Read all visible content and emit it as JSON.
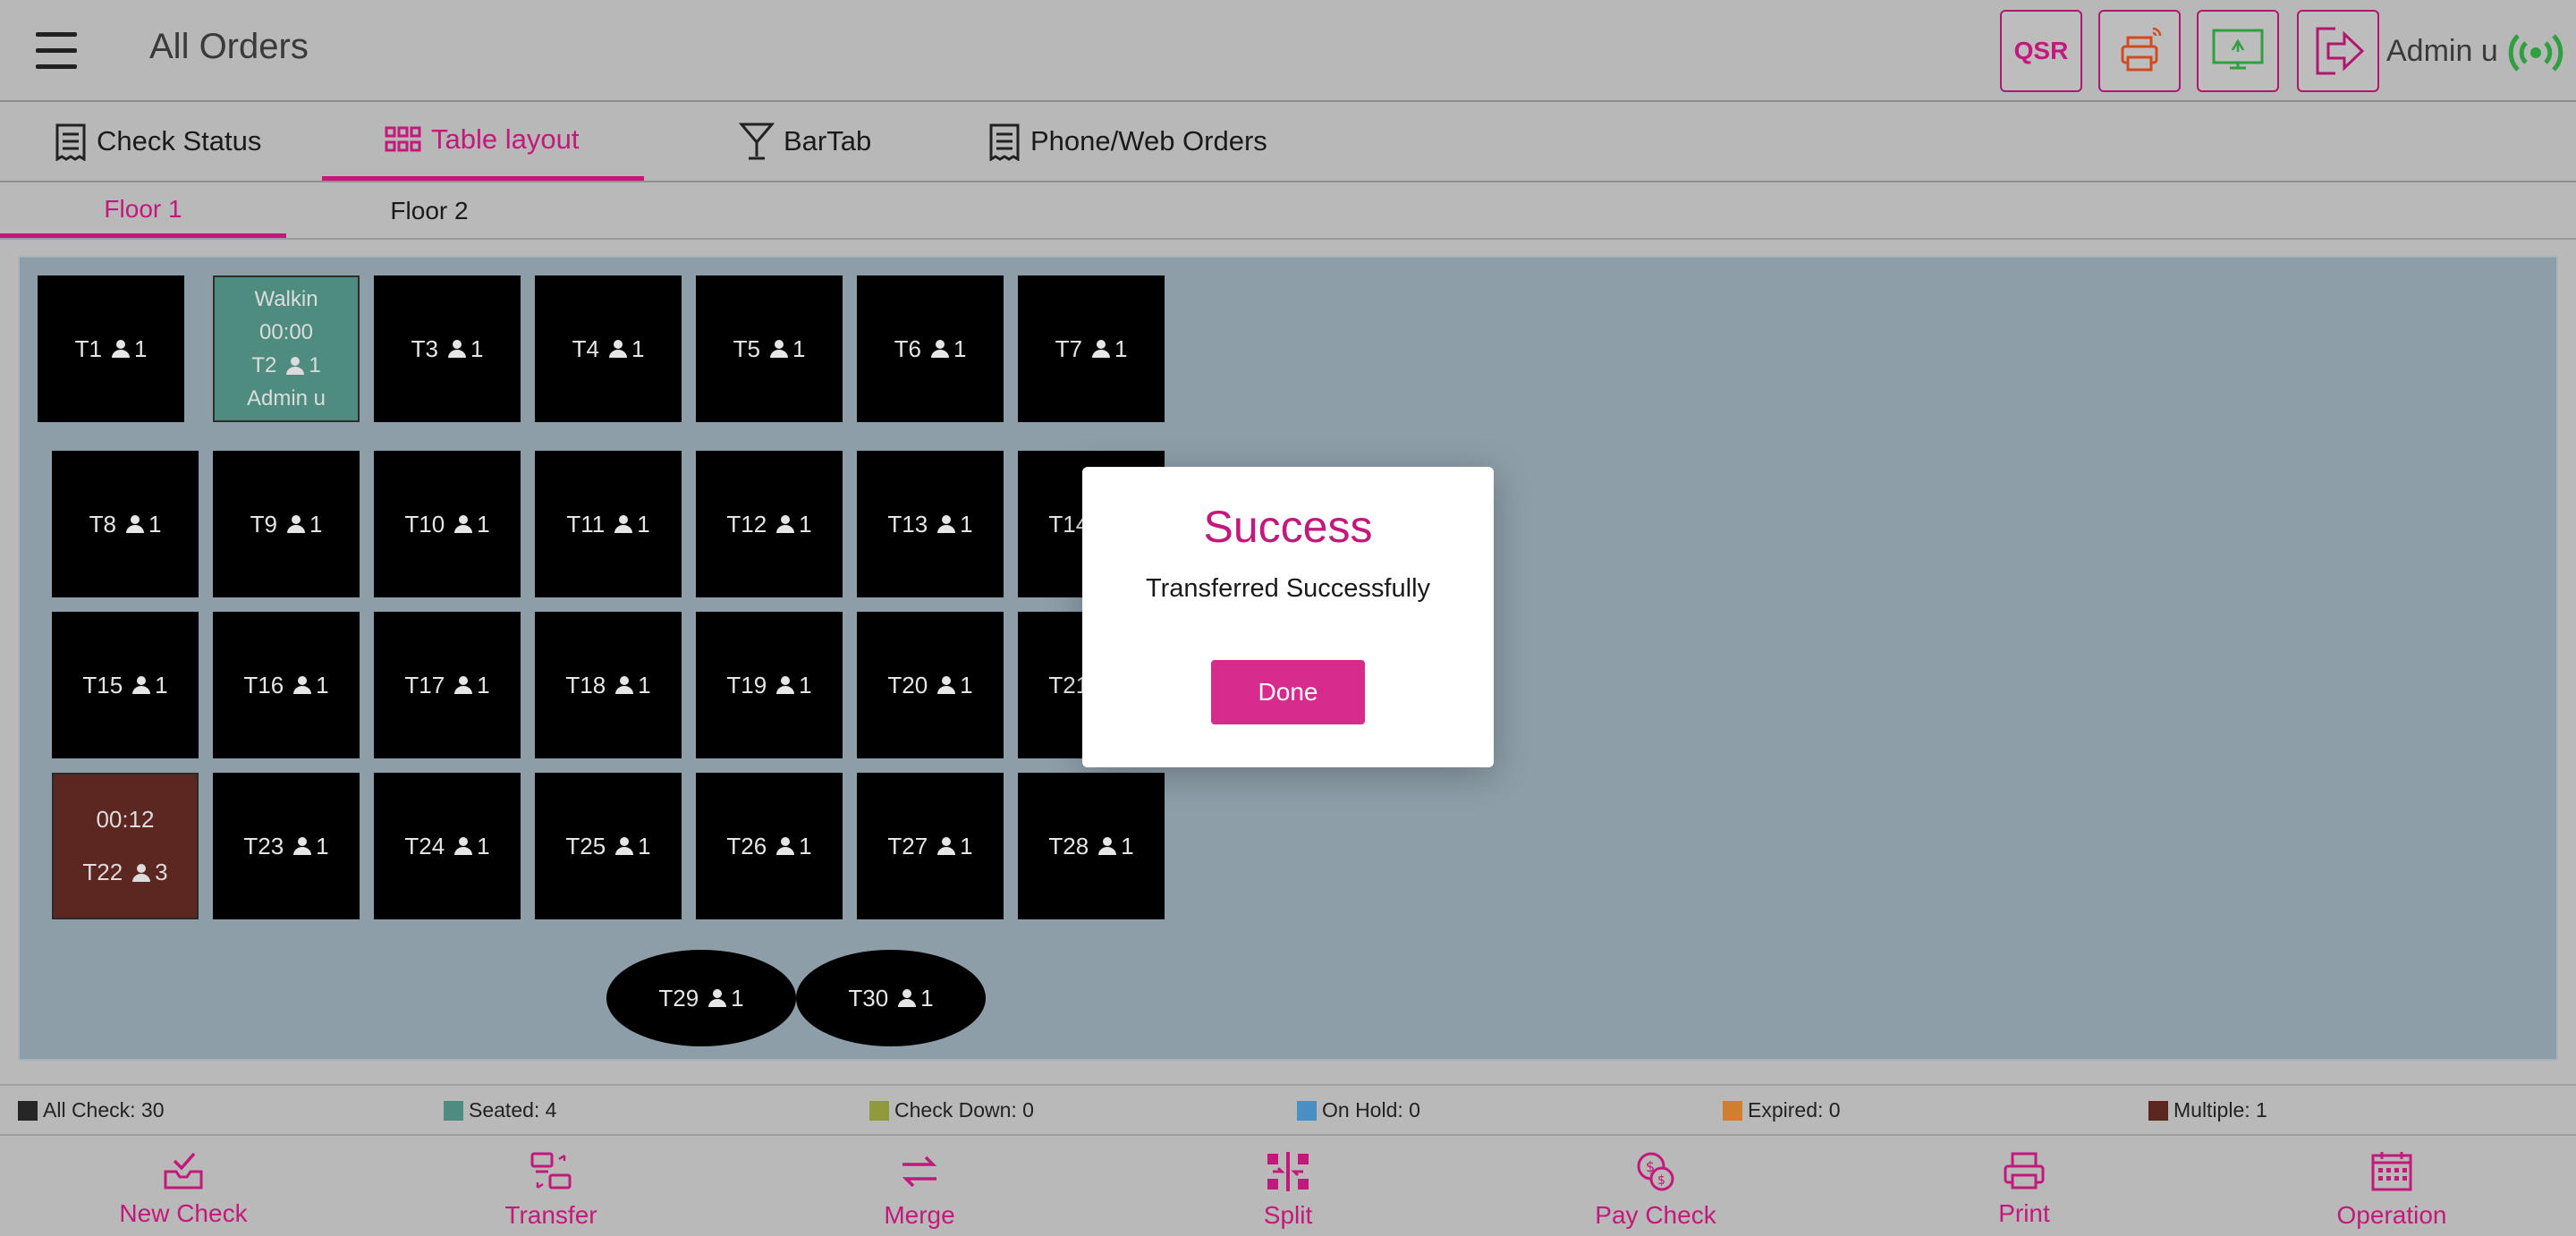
{
  "header": {
    "title": "All Orders",
    "qsr_label": "QSR",
    "user_name": "Admin u",
    "menu_icon": "hamburger-menu-icon",
    "printer_icon": "printer-icon",
    "display_icon": "monitor-sync-icon",
    "logout_icon": "logout-icon",
    "status_icon": "wifi-signal-icon"
  },
  "tabs": [
    {
      "label": "Check Status",
      "icon": "receipt-icon",
      "active": false
    },
    {
      "label": "Table layout",
      "icon": "grid-icon",
      "active": true
    },
    {
      "label": "BarTab",
      "icon": "cocktail-icon",
      "active": false
    },
    {
      "label": "Phone/Web Orders",
      "icon": "receipt-icon",
      "active": false
    }
  ],
  "floors": [
    {
      "label": "Floor 1",
      "active": true
    },
    {
      "label": "Floor 2",
      "active": false
    }
  ],
  "tables": [
    {
      "name": "T1",
      "guests": "1"
    },
    {
      "name": "T2",
      "guests": "1",
      "customer": "Walkin",
      "time": "00:00",
      "server": "Admin u",
      "status": "seated"
    },
    {
      "name": "T3",
      "guests": "1"
    },
    {
      "name": "T4",
      "guests": "1"
    },
    {
      "name": "T5",
      "guests": "1"
    },
    {
      "name": "T6",
      "guests": "1"
    },
    {
      "name": "T7",
      "guests": "1"
    },
    {
      "name": "T8",
      "guests": "1"
    },
    {
      "name": "T9",
      "guests": "1"
    },
    {
      "name": "T10",
      "guests": "1"
    },
    {
      "name": "T11",
      "guests": "1"
    },
    {
      "name": "T12",
      "guests": "1"
    },
    {
      "name": "T13",
      "guests": "1"
    },
    {
      "name": "T14",
      "guests": "1"
    },
    {
      "name": "T15",
      "guests": "1"
    },
    {
      "name": "T16",
      "guests": "1"
    },
    {
      "name": "T17",
      "guests": "1"
    },
    {
      "name": "T18",
      "guests": "1"
    },
    {
      "name": "T19",
      "guests": "1"
    },
    {
      "name": "T20",
      "guests": "1"
    },
    {
      "name": "T21",
      "guests": "1"
    },
    {
      "name": "T22",
      "guests": "3",
      "time": "00:12",
      "status": "multiple"
    },
    {
      "name": "T23",
      "guests": "1"
    },
    {
      "name": "T24",
      "guests": "1"
    },
    {
      "name": "T25",
      "guests": "1"
    },
    {
      "name": "T26",
      "guests": "1"
    },
    {
      "name": "T27",
      "guests": "1"
    },
    {
      "name": "T28",
      "guests": "1"
    },
    {
      "name": "T29",
      "guests": "1",
      "shape": "oval"
    },
    {
      "name": "T30",
      "guests": "1",
      "shape": "oval"
    }
  ],
  "legend": [
    {
      "label": "All Check: 30",
      "color": "#262626"
    },
    {
      "label": "Seated: 4",
      "color": "#4f8c80"
    },
    {
      "label": "Check Down: 0",
      "color": "#8f9a3a"
    },
    {
      "label": "On Hold: 0",
      "color": "#4a8fc4"
    },
    {
      "label": "Expired: 0",
      "color": "#cf7f2e"
    },
    {
      "label": "Multiple: 1",
      "color": "#5b2720"
    }
  ],
  "actions": [
    {
      "label": "New Check",
      "icon": "inbox-check-icon"
    },
    {
      "label": "Transfer",
      "icon": "transfer-icon"
    },
    {
      "label": "Merge",
      "icon": "merge-arrows-icon"
    },
    {
      "label": "Split",
      "icon": "split-icon"
    },
    {
      "label": "Pay Check",
      "icon": "coins-icon"
    },
    {
      "label": "Print",
      "icon": "printer-icon"
    },
    {
      "label": "Operation",
      "icon": "calendar-icon"
    }
  ],
  "modal": {
    "title": "Success",
    "message": "Transferred Successfully",
    "button": "Done"
  },
  "colors": {
    "accent": "#c3197c",
    "button": "#d62b8c",
    "canvas": "#8d9ea8"
  }
}
